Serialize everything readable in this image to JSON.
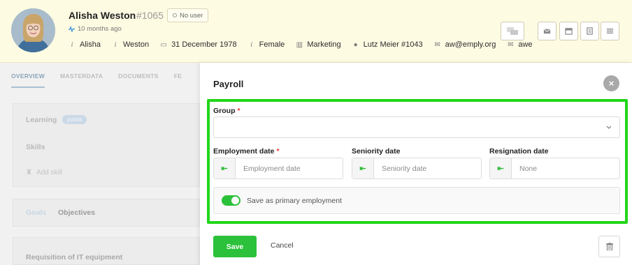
{
  "profile": {
    "name": "Alisha Weston",
    "employee_no": "#1065",
    "user_status": "No user",
    "last_active": "10 months ago",
    "first_name": "Alisha",
    "last_name": "Weston",
    "birth_date": "31 December 1978",
    "gender": "Female",
    "department": "Marketing",
    "manager": "Lutz Meier #1043",
    "email": "aw@emply.org",
    "initials": "awe"
  },
  "header_icons": [
    "chat-icon",
    "mail-icon",
    "calendar-icon",
    "document-icon",
    "menu-icon"
  ],
  "background": {
    "tabs": [
      "OVERVIEW",
      "MASTERDATA",
      "DOCUMENTS",
      "FE"
    ],
    "learning_label": "Learning",
    "learning_badge": "points",
    "skills_label": "Skills",
    "add_skill": "Add skill",
    "goals_label": "Goals",
    "objectives_label": "Objectives",
    "requisition_label": "Requisition of IT equipment"
  },
  "modal": {
    "title": "Payroll",
    "group_label": "Group",
    "group_value": "",
    "employment_date_label": "Employment date",
    "employment_date_placeholder": "Employment date",
    "seniority_date_label": "Seniority date",
    "seniority_date_placeholder": "Seniority date",
    "resignation_date_label": "Resignation date",
    "resignation_date_placeholder": "None",
    "primary_employment_label": "Save as primary employment",
    "primary_employment_on": true,
    "save_label": "Save",
    "cancel_label": "Cancel",
    "required_marker": "*",
    "date_addon_icon": "⇤"
  },
  "colors": {
    "accent_green": "#2bc13a",
    "highlight_green": "#22d61a",
    "header_bg": "#fefbe3",
    "required_red": "#e53935"
  }
}
